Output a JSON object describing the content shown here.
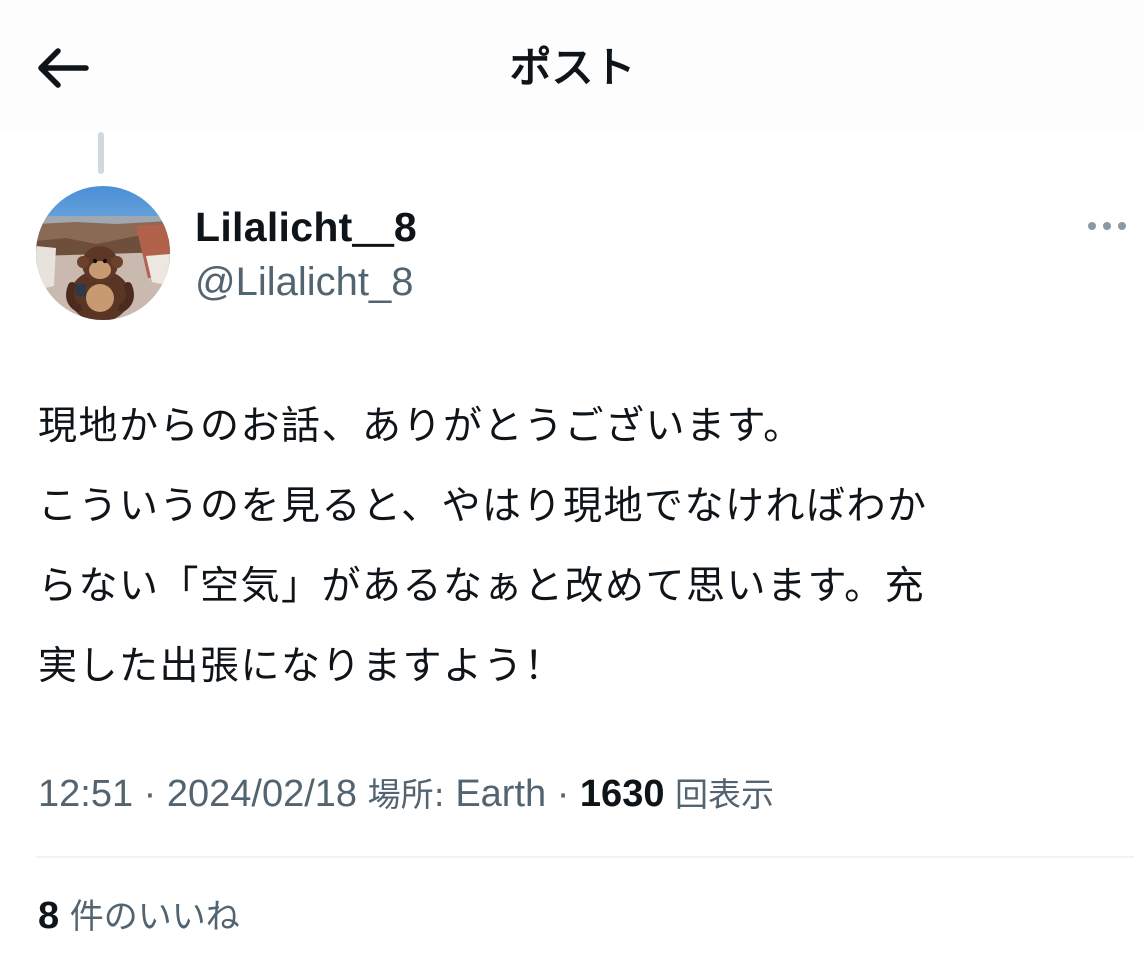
{
  "header": {
    "title": "ポスト",
    "back_icon": "arrow-left-icon"
  },
  "author": {
    "display_name": "Lilalicht＿8",
    "handle": "@Lilalicht_8",
    "avatar": "avatar-photo-monkey-plush-canyon"
  },
  "more_icon": "more-dots-icon",
  "tweet": {
    "lines": [
      "現地からのお話、ありがとうございます。",
      "こういうのを見ると、やはり現地でなければわか",
      "らない「空気」があるなぁと改めて思います。充",
      "実した出張になりますよう！"
    ]
  },
  "meta": {
    "time": "12:51",
    "separator": " · ",
    "date": "2024/02/18",
    "location_label": "場所:",
    "location_value": "Earth",
    "views_count": "1630",
    "views_label": "回表示"
  },
  "likes": {
    "count": "8",
    "label": "件のいいね"
  },
  "colors": {
    "text_primary": "#0f1419",
    "text_secondary": "#536471",
    "divider": "#eff3f4",
    "thread_line": "#cfd9de"
  }
}
